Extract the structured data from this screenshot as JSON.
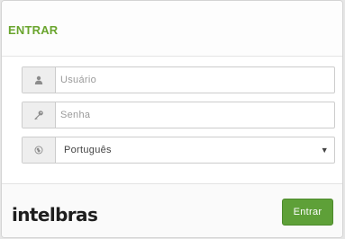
{
  "login": {
    "title": "ENTRAR",
    "username_placeholder": "Usuário",
    "password_placeholder": "Senha",
    "language_selected": "Português",
    "submit_label": "Entrar",
    "brand_logo": "intelbras"
  },
  "icons": {
    "username": "user-icon",
    "password": "key-icon",
    "language": "globe-icon",
    "select": "chevron-down-icon"
  },
  "colors": {
    "accent": "#6aa52e",
    "button": "#5ea038"
  }
}
